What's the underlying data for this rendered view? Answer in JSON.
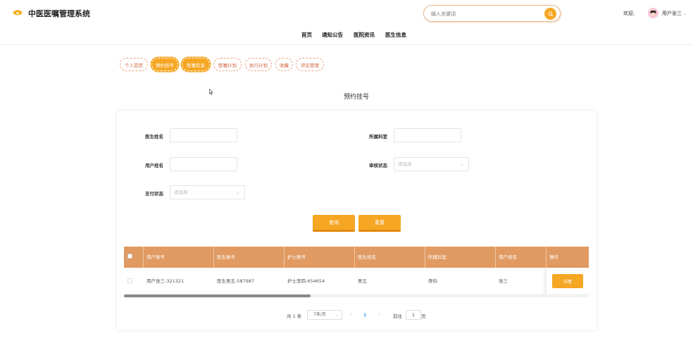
{
  "header": {
    "app_title": "中医医嘱管理系统",
    "search_placeholder": "输入关键词",
    "welcome": "欢迎,",
    "user_name": "用户张三"
  },
  "nav": [
    "首页",
    "通知公告",
    "医院资讯",
    "医生信息"
  ],
  "tabs": [
    {
      "label": "个人首页",
      "active": false
    },
    {
      "label": "预约挂号",
      "active": true
    },
    {
      "label": "医嘱信息",
      "active": true
    },
    {
      "label": "医嘱计划",
      "active": false
    },
    {
      "label": "执行计划",
      "active": false
    },
    {
      "label": "收藏",
      "active": false
    },
    {
      "label": "评论管理",
      "active": false
    }
  ],
  "page_title": "预约挂号",
  "form": {
    "doctor_name_label": "医生姓名",
    "department_label": "所属科室",
    "user_name_label": "用户姓名",
    "review_status_label": "审核状态",
    "review_status_placeholder": "请选择",
    "pay_status_label": "支付状态",
    "pay_status_placeholder": "请选择",
    "query_button": "查询",
    "reset_button": "重置"
  },
  "table": {
    "columns": [
      "用户账号",
      "医生账号",
      "护士账号",
      "医生姓名",
      "所属科室",
      "用户姓名",
      "操作"
    ],
    "rows": [
      [
        "用户张三-321321",
        "医生吴五-587987",
        "护士李四-654654",
        "吴五",
        "骨科",
        "张三"
      ]
    ],
    "detail_button": "详情"
  },
  "pagination": {
    "total": "共 1 条",
    "page_size": "7条/页",
    "current_page": "1",
    "goto_label": "前往",
    "goto_value": "1",
    "page_suffix": "页"
  },
  "colors": {
    "accent": "#f5a623",
    "table_header": "#e09a62",
    "tab_border": "#e8a080"
  }
}
